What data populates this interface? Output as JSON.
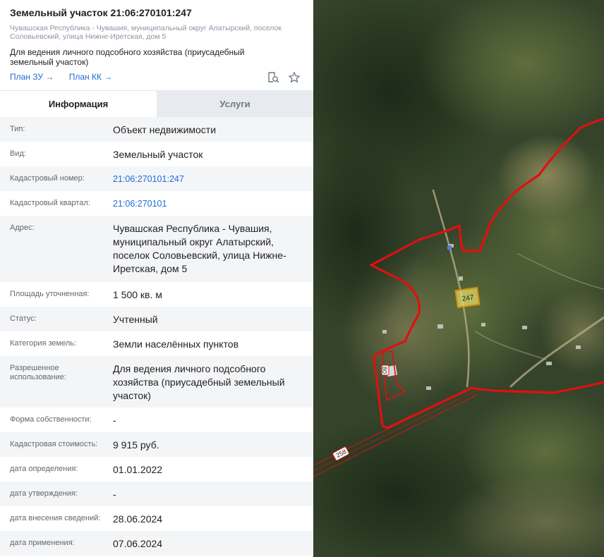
{
  "header": {
    "title": "Земельный участок 21:06:270101:247",
    "address_small": "Чувашская Республика - Чувашия, муниципальный округ Алатырский, поселок Соловьевский, улица Нижне-Иретская, дом 5",
    "purpose": "Для ведения личного подсобного хозяйства (приусадебный земельный участок)",
    "plan_zu": "План ЗУ →",
    "plan_kk": "План КК →"
  },
  "tabs": {
    "info": "Информация",
    "services": "Услуги"
  },
  "info": [
    {
      "label": "Тип:",
      "value": "Объект недвижимости"
    },
    {
      "label": "Вид:",
      "value": "Земельный участок"
    },
    {
      "label": "Кадастровый номер:",
      "value": "21:06:270101:247"
    },
    {
      "label": "Кадастровый квартал:",
      "value": "21:06:270101"
    },
    {
      "label": "Адрес:",
      "value": "Чувашская Республика - Чувашия, муниципальный округ Алатырский, поселок Соловьевский, улица Нижне-Иретская, дом 5"
    },
    {
      "label": "Площадь уточненная:",
      "value": "1 500 кв. м"
    },
    {
      "label": "Статус:",
      "value": "Учтенный"
    },
    {
      "label": "Категория земель:",
      "value": "Земли населённых пунктов"
    },
    {
      "label": "Разрешенное использование:",
      "value": "Для ведения личного подсобного хозяйства (приусадебный земельный участок)"
    },
    {
      "label": "Форма собственности:",
      "value": "-"
    },
    {
      "label": "Кадастровая стоимость:",
      "value": "9 915 руб."
    },
    {
      "label": "дата определения:",
      "value": "01.01.2022"
    },
    {
      "label": "дата утверждения:",
      "value": "-"
    },
    {
      "label": "дата внесения сведений:",
      "value": "28.06.2024"
    },
    {
      "label": "дата применения:",
      "value": "07.06.2024"
    }
  ],
  "map": {
    "parcel_label": "247",
    "parcel_label_2": "80",
    "road_label": "258",
    "colors": {
      "boundary": "#e01010",
      "parcel_fill": "#e8e26a",
      "parcel_stroke": "#d98a10"
    }
  }
}
